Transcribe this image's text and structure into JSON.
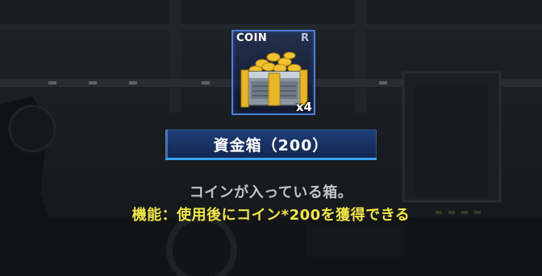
{
  "item": {
    "category": "COIN",
    "rarity": "R",
    "quantity": "x4",
    "name": "資金箱（200）",
    "icon": "coin-crate-icon"
  },
  "details": {
    "description": "コインが入っている箱。",
    "function": "機能：使用後にコイン*200を獲得できる"
  },
  "colors": {
    "card_border": "#4f7fd6",
    "name_bar": "#17305f",
    "name_bar_accent": "#3aa0f0",
    "function_text": "#f2e64a",
    "description_text": "#bfc2c6"
  }
}
